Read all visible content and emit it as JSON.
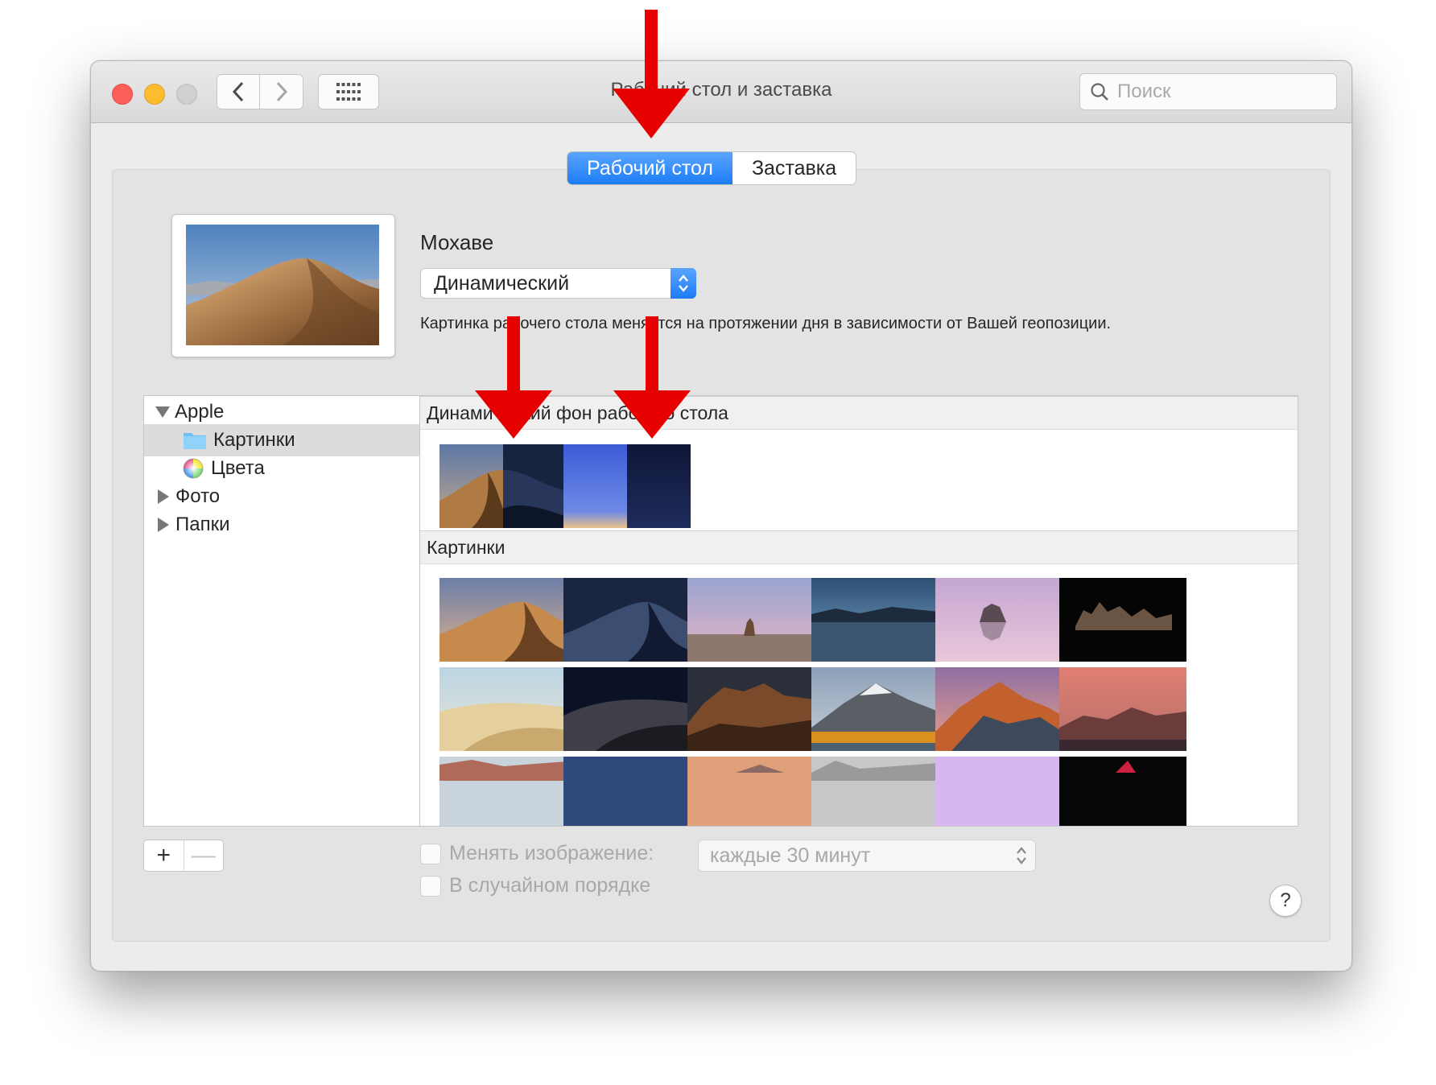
{
  "window": {
    "title": "Рабочий стол и заставка",
    "search_placeholder": "Поиск"
  },
  "tabs": [
    {
      "label": "Рабочий стол",
      "active": true
    },
    {
      "label": "Заставка",
      "active": false
    }
  ],
  "current_wallpaper": {
    "name": "Мохаве",
    "mode": "Динамический",
    "description": "Картинка рабочего стола меняется на протяжении дня в зависимости от Вашей геопозиции."
  },
  "sidebar": {
    "items": [
      {
        "label": "Apple",
        "expanded": true
      },
      {
        "label": "Картинки",
        "selected": true
      },
      {
        "label": "Цвета"
      },
      {
        "label": "Фото",
        "expanded": false
      },
      {
        "label": "Папки",
        "expanded": false
      }
    ]
  },
  "sections": {
    "dynamic": "Динамический фон рабочего стола",
    "pictures": "Картинки"
  },
  "controls": {
    "change_picture_label": "Менять изображение:",
    "interval": "каждые 30 минут",
    "random_order_label": "В случайном порядке",
    "help": "?",
    "add": "+",
    "remove": "—"
  },
  "icons": [
    "back-chevron-icon",
    "forward-chevron-icon",
    "grid-icon",
    "search-icon",
    "folder-icon",
    "color-wheel-icon",
    "annotation-arrow"
  ],
  "colors": {
    "accent": "#1d7cf5",
    "close": "#fc5f57",
    "minimize": "#fdbc2e",
    "arrow": "#e60000"
  }
}
